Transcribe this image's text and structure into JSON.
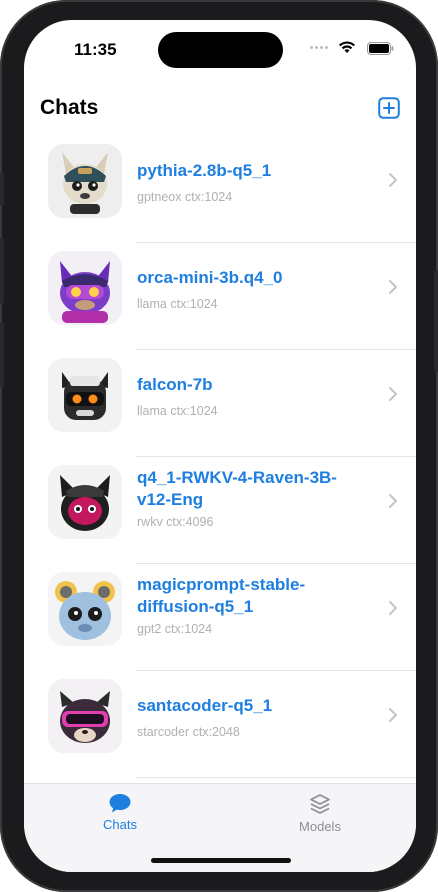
{
  "status": {
    "time": "11:35"
  },
  "header": {
    "title": "Chats"
  },
  "chats": [
    {
      "name": "pythia-2.8b-q5_1",
      "subtitle": "gptneox ctx:1024"
    },
    {
      "name": "orca-mini-3b.q4_0",
      "subtitle": "llama ctx:1024"
    },
    {
      "name": "falcon-7b",
      "subtitle": "llama ctx:1024"
    },
    {
      "name": "q4_1-RWKV-4-Raven-3B-v12-Eng",
      "subtitle": "rwkv ctx:4096"
    },
    {
      "name": "magicprompt-stable-diffusion-q5_1",
      "subtitle": "gpt2 ctx:1024"
    },
    {
      "name": "santacoder-q5_1",
      "subtitle": "starcoder ctx:2048"
    }
  ],
  "tabs": {
    "chats_label": "Chats",
    "models_label": "Models"
  },
  "colors": {
    "accent": "#1e7fe0",
    "subtitle": "#b0b0b5",
    "tabbar": "#f5f5f7"
  }
}
